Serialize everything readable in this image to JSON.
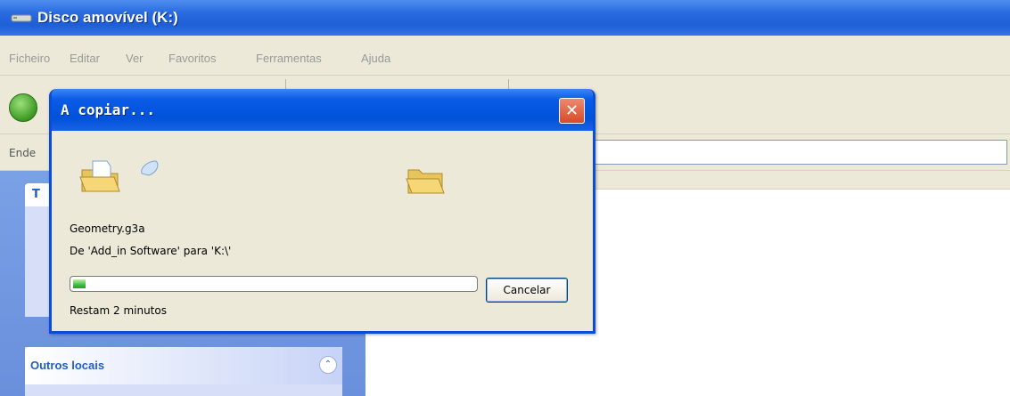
{
  "window": {
    "title": "Disco amovível (K:)",
    "drive_icon": "drive-icon"
  },
  "menu": {
    "items": [
      "Ficheiro",
      "Editar",
      "Ver",
      "Favoritos",
      "Ferramentas",
      "Ajuda"
    ]
  },
  "toolbar": {
    "back_icon": "back-arrow-icon"
  },
  "address": {
    "label": "Ende"
  },
  "sidebar": {
    "task_header_initial": "T",
    "other_places_title": "Outros locais",
    "collapse_icon": "collapse-chevron-icon"
  },
  "dialog": {
    "title": "A copiar...",
    "close_icon": "close-icon",
    "file_name": "Geometry.g3a",
    "from_to": "De 'Add_in Software' para 'K:\\'",
    "progress_fraction": 0.03,
    "cancel_label": "Cancelar",
    "time_remaining": "Restam 2 minutos",
    "accent_color": "#0a4ed8"
  }
}
